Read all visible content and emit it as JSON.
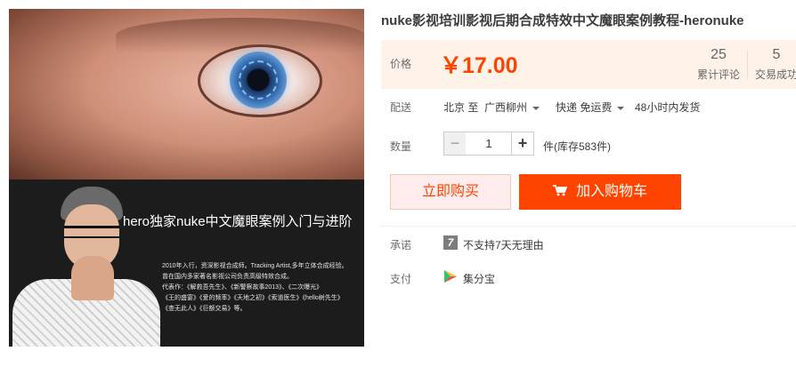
{
  "product": {
    "title": "nuke影视培训影视后期合成特效中文魔眼案例教程-heronuke"
  },
  "hero_image": {
    "headline": "hero独家nuke中文魔眼案例入门与进阶",
    "bio_lines": [
      "2010年入行，资深影视合成师。Tracking Artist,多年立体合成经验。",
      "曾在国内多家著名影视公司负责高级特效合成。",
      "代表作：《解救吾先生》、《新警察故事2013》、《二次曝光》",
      "《王的盛宴》《爱的频率》《天地之初》《索道医生》《hello树先生》",
      "《查无此人》《巨额交易》等。"
    ]
  },
  "price": {
    "label": "价格",
    "value": "￥17.00"
  },
  "stats": {
    "comments_count": "25",
    "comments_label": "累计评论",
    "trades_count": "5",
    "trades_label": "交易成功"
  },
  "shipping": {
    "label": "配送",
    "from": "北京 至",
    "to": "广西柳州",
    "method": "快递 免运费",
    "dispatch": "48小时内发货"
  },
  "quantity": {
    "label": "数量",
    "minus": "−",
    "value": "1",
    "plus": "+",
    "stock": "件(库存583件)"
  },
  "actions": {
    "buy_now": "立即购买",
    "add_to_cart": "加入购物车"
  },
  "promise": {
    "label": "承诺",
    "icon_text": "7",
    "text": "不支持7天无理由"
  },
  "payment": {
    "label": "支付",
    "method": "集分宝"
  },
  "colors": {
    "accent": "#ff4400",
    "price_bg": "#fff2e8"
  }
}
